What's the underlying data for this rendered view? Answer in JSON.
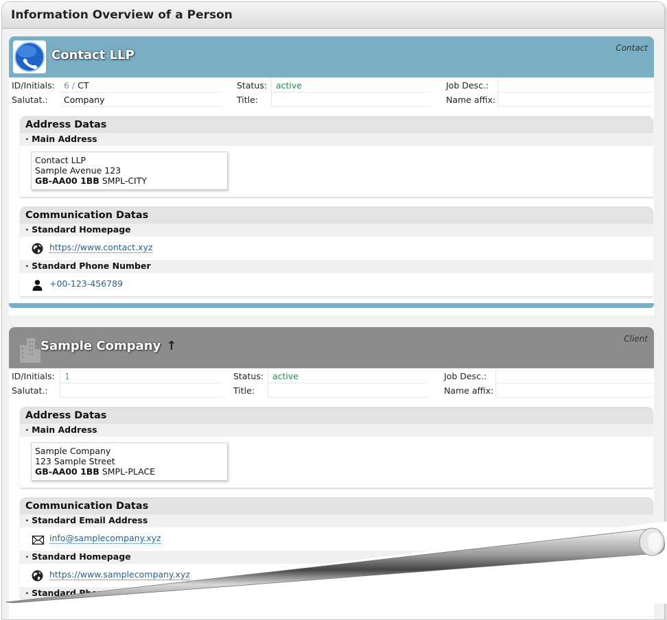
{
  "window": {
    "title": "Information Overview of a Person"
  },
  "labels": {
    "id_initials": "ID/Initials:",
    "status": "Status:",
    "job_desc": "Job Desc.:",
    "salutat": "Salutat.:",
    "title": "Title:",
    "name_affix": "Name affix:",
    "address_datas": "Address Datas",
    "main_address": "· Main Address",
    "communication_datas": "Communication Datas",
    "standard_homepage": "· Standard Homepage",
    "standard_phone": "· Standard Phone Number",
    "standard_email": "· Standard Email Address",
    "standard_phone_cut": "· Standard Phone Number"
  },
  "contact": {
    "name": "Contact LLP",
    "role": "Contact",
    "id": "6",
    "id_sep": " / ",
    "initials": "CT",
    "status": "active",
    "salutation": "Company",
    "address": {
      "line1": "Contact LLP",
      "line2": "Sample Avenue 123",
      "postcode": "GB-AA00 1BB",
      "city": "SMPL-CITY"
    },
    "homepage": "https://www.contact.xyz",
    "phone": "+00-123-456789"
  },
  "client": {
    "name": "Sample Company",
    "up_arrow": "↑",
    "role": "Client",
    "id": "1",
    "status": "active",
    "address": {
      "line1": "Sample Company",
      "line2": "123 Sample Street",
      "postcode": "GB-AA00 1BB",
      "city": "SMPL-PLACE"
    },
    "email": "info@samplecompany.xyz",
    "homepage": "https://www.samplecompany.xyz"
  },
  "colors": {
    "contact_header": "#7aaec5",
    "client_header": "#8c8c8c",
    "status_active": "#2b8a4a",
    "link": "#27608a"
  },
  "icons": {
    "contact_icon": "phone-bubble-icon",
    "client_icon": "building-icon",
    "homepage_icon": "globe-icon",
    "phone_icon": "person-icon",
    "email_icon": "envelope-icon"
  }
}
